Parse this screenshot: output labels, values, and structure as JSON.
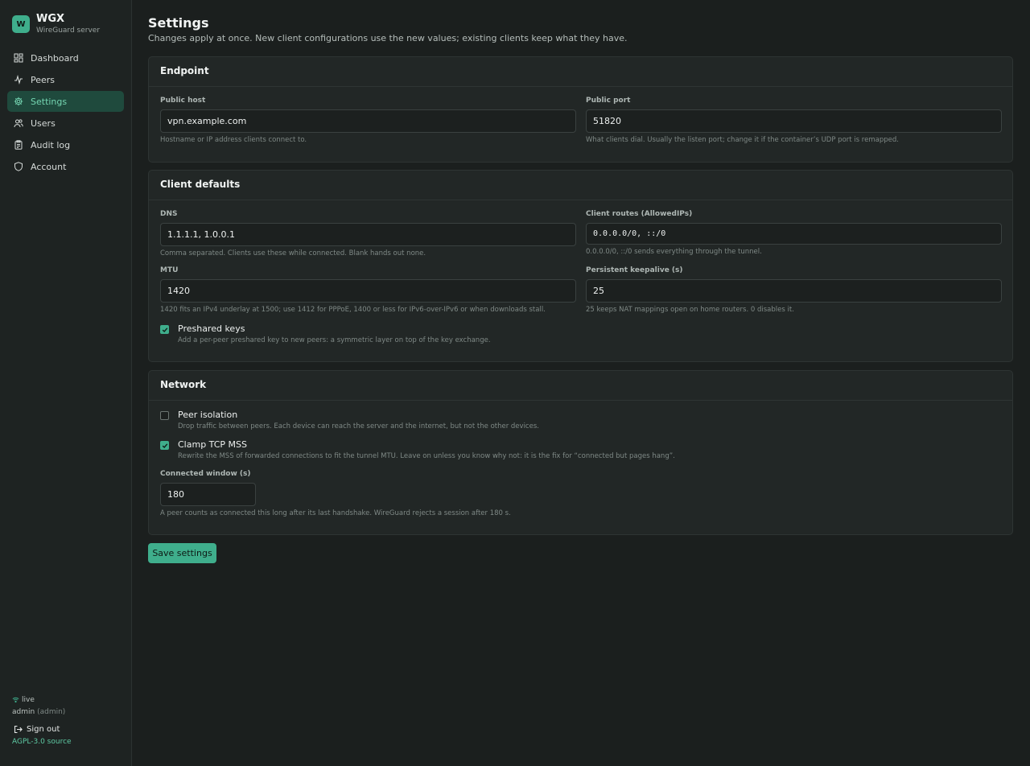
{
  "brand": {
    "logo_letter": "W",
    "name": "WGX",
    "subtitle": "WireGuard server"
  },
  "nav": [
    {
      "label": "Dashboard",
      "icon": "grid-icon"
    },
    {
      "label": "Peers",
      "icon": "activity-icon"
    },
    {
      "label": "Settings",
      "icon": "gear-icon",
      "active": true
    },
    {
      "label": "Users",
      "icon": "users-icon"
    },
    {
      "label": "Audit log",
      "icon": "clipboard-icon"
    },
    {
      "label": "Account",
      "icon": "shield-icon"
    }
  ],
  "footer": {
    "status": "live",
    "user": "admin",
    "role": "(admin)",
    "signout": "Sign out",
    "license": "AGPL-3.0 source"
  },
  "page": {
    "title": "Settings",
    "subtitle": "Changes apply at once. New client configurations use the new values; existing clients keep what they have."
  },
  "endpoint": {
    "title": "Endpoint",
    "public_host": {
      "label": "Public host",
      "value": "vpn.example.com",
      "help": "Hostname or IP address clients connect to."
    },
    "public_port": {
      "label": "Public port",
      "value": "51820",
      "help": "What clients dial. Usually the listen port; change it if the container’s UDP port is remapped."
    }
  },
  "client_defaults": {
    "title": "Client defaults",
    "dns": {
      "label": "DNS",
      "value": "1.1.1.1, 1.0.0.1",
      "help": "Comma separated. Clients use these while connected. Blank hands out none."
    },
    "routes": {
      "label": "Client routes (AllowedIPs)",
      "value": "0.0.0.0/0, ::/0",
      "help": "0.0.0.0/0, ::/0 sends everything through the tunnel."
    },
    "mtu": {
      "label": "MTU",
      "value": "1420",
      "help": "1420 fits an IPv4 underlay at 1500; use 1412 for PPPoE, 1400 or less for IPv6-over-IPv6 or when downloads stall."
    },
    "keepalive": {
      "label": "Persistent keepalive (s)",
      "value": "25",
      "help": "25 keeps NAT mappings open on home routers. 0 disables it."
    },
    "preshared": {
      "label": "Preshared keys",
      "checked": true,
      "help": "Add a per-peer preshared key to new peers: a symmetric layer on top of the key exchange."
    }
  },
  "network": {
    "title": "Network",
    "isolation": {
      "label": "Peer isolation",
      "checked": false,
      "help": "Drop traffic between peers. Each device can reach the server and the internet, but not the other devices."
    },
    "clamp": {
      "label": "Clamp TCP MSS",
      "checked": true,
      "help": "Rewrite the MSS of forwarded connections to fit the tunnel MTU. Leave on unless you know why not: it is the fix for “connected but pages hang”."
    },
    "window": {
      "label": "Connected window (s)",
      "value": "180",
      "help": "A peer counts as connected this long after its last handshake. WireGuard rejects a session after 180 s."
    }
  },
  "save_label": "Save settings",
  "colors": {
    "accent": "#3fae8c",
    "background": "#1b1f1e",
    "card": "#222726",
    "active_nav": "#1f4a3d"
  }
}
